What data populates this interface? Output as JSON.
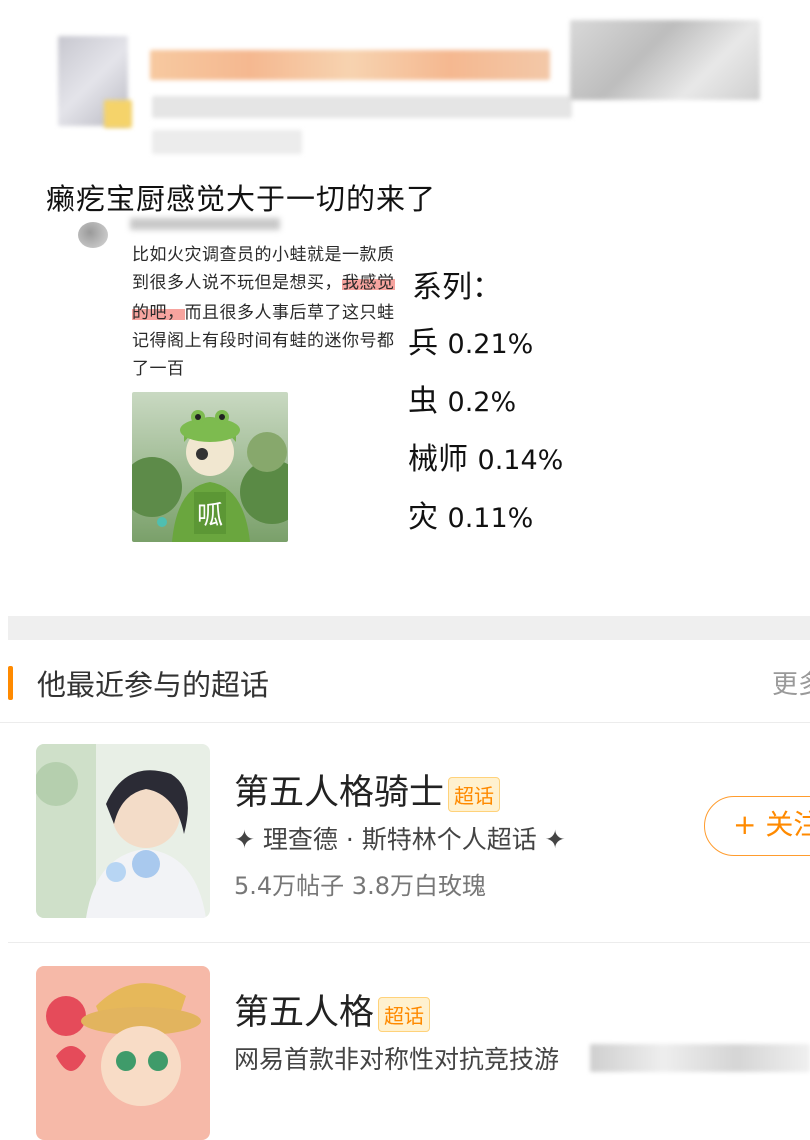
{
  "post": {
    "title": "癞疙宝厨感觉大于一切的来了"
  },
  "quoted_comment": {
    "lines": [
      "比如火灾调查员的小蛙就是一款质",
      "到很多人说不玩但是想买，",
      "我感觉",
      "的吧，",
      "而且很多人事后草了这只蛙",
      "记得阁上有段时间有蛙的迷你号都",
      "了一百"
    ],
    "image_text": "呱"
  },
  "stats": {
    "header": "系列：",
    "rows": [
      {
        "name": "兵",
        "pct": "0.21%"
      },
      {
        "name": "虫",
        "pct": "0.2%"
      },
      {
        "name": "械师",
        "pct": "0.14%"
      },
      {
        "name": "灾",
        "pct": "0.11%"
      }
    ]
  },
  "section": {
    "title": "他最近参与的超话",
    "more": "更多"
  },
  "topics": [
    {
      "name": "第五人格骑士",
      "badge": "超话",
      "desc": "✦ 理查德 · 斯特林个人超话 ✦",
      "stats": "5.4万帖子 3.8万白玫瑰",
      "follow": "+ 关注"
    },
    {
      "name": "第五人格",
      "badge": "超话",
      "desc": "网易首款非对称性对抗竞技游"
    }
  ],
  "colors": {
    "accent": "#ff8a00",
    "highlight": "#f05a50"
  }
}
